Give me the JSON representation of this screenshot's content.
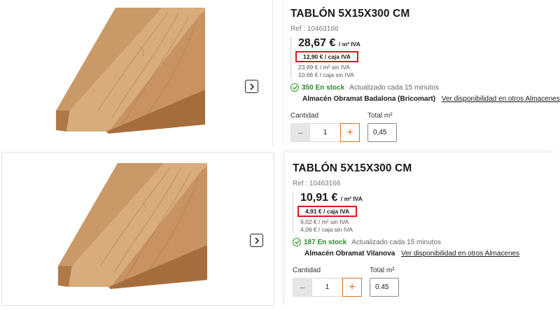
{
  "products": [
    {
      "title": "TABLÓN 5X15X300 CM",
      "ref": "Ref : 10463166",
      "price_main": "28,67 €",
      "price_main_unit": "/ m² IVA",
      "price_box": "12,90 € / caja IVA",
      "price_sub1": "23,69 € / m² sin IVA",
      "price_sub2": "10,66 € / caja sin IVA",
      "stock_count": "350 En stock",
      "stock_note": "Actualizado cada 15 minutos",
      "store_name": "Almacén Obramat Badalona (Bricomart)",
      "store_link": "Ver disponibilidad en otros Almacenes",
      "qty_label": "Cantidad",
      "qty_minus": "−",
      "qty_value": "1",
      "qty_plus": "+",
      "total_label": "Total m²",
      "total_value": "0,45"
    },
    {
      "title": "TABLÓN 5X15X300 CM",
      "ref": "Ref : 10463166",
      "price_main": "10,91 €",
      "price_main_unit": "/ m² IVA",
      "price_box": "4,91 € / caja IVA",
      "price_sub1": "9,02 € / m² sin IVA",
      "price_sub2": "4,06 € / caja sin IVA",
      "stock_count": "187 En stock",
      "stock_note": "Actualizado cada 15 minutos",
      "store_name": "Almacén Obramat Vilanova",
      "store_link": "Ver disponibilidad en otros Almacenes",
      "qty_label": "Cantidad",
      "qty_minus": "−",
      "qty_value": "1",
      "qty_plus": "+",
      "total_label": "Total m²",
      "total_value": "0.45"
    }
  ],
  "icons": {
    "next": "chevron-right-icon",
    "stock": "check-circle-icon"
  },
  "colors": {
    "highlight": "#e1141e",
    "stock_green": "#2c8a2c",
    "accent_orange": "#e07020"
  }
}
